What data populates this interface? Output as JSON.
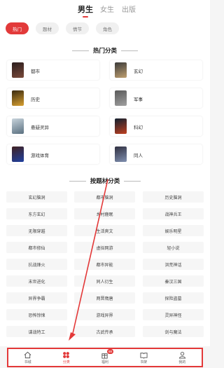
{
  "gender_tabs": [
    "男生",
    "女生",
    "出版"
  ],
  "chips": [
    "热门",
    "题材",
    "情节",
    "角色"
  ],
  "sections": {
    "hot": "热门分类",
    "theme": "按题材分类"
  },
  "hot_categories": [
    "都市",
    "玄幻",
    "历史",
    "军事",
    "悬疑灵异",
    "科幻",
    "游戏体育",
    "同人"
  ],
  "theme_tags": [
    "玄幻脑洞",
    "都市脑洞",
    "历史脑洞",
    "东方玄幻",
    "乡村鹿眠",
    "战神兵王",
    "无限穿越",
    "生活爽文",
    "娱乐明星",
    "都市修仙",
    "虚拟网游",
    "轻小说",
    "抗战烽火",
    "都市异能",
    "洪荒神话",
    "末世进化",
    "同人衍生",
    "秦汉三国",
    "异界争霸",
    "两晋隋唐",
    "探险盗墓",
    "恐怖惊悚",
    "游戏异界",
    "灵异神怪",
    "谍战特工",
    "古武传承",
    "剑与魔法"
  ],
  "bottom_nav": [
    {
      "label": "书城",
      "icon": "home-icon"
    },
    {
      "label": "分类",
      "icon": "category-icon"
    },
    {
      "label": "福利",
      "icon": "gift-icon",
      "badge": "88"
    },
    {
      "label": "书架",
      "icon": "bookshelf-icon"
    },
    {
      "label": "我的",
      "icon": "profile-icon"
    }
  ],
  "colors": {
    "accent": "#e23a3a",
    "background": "#f5f5f5"
  }
}
